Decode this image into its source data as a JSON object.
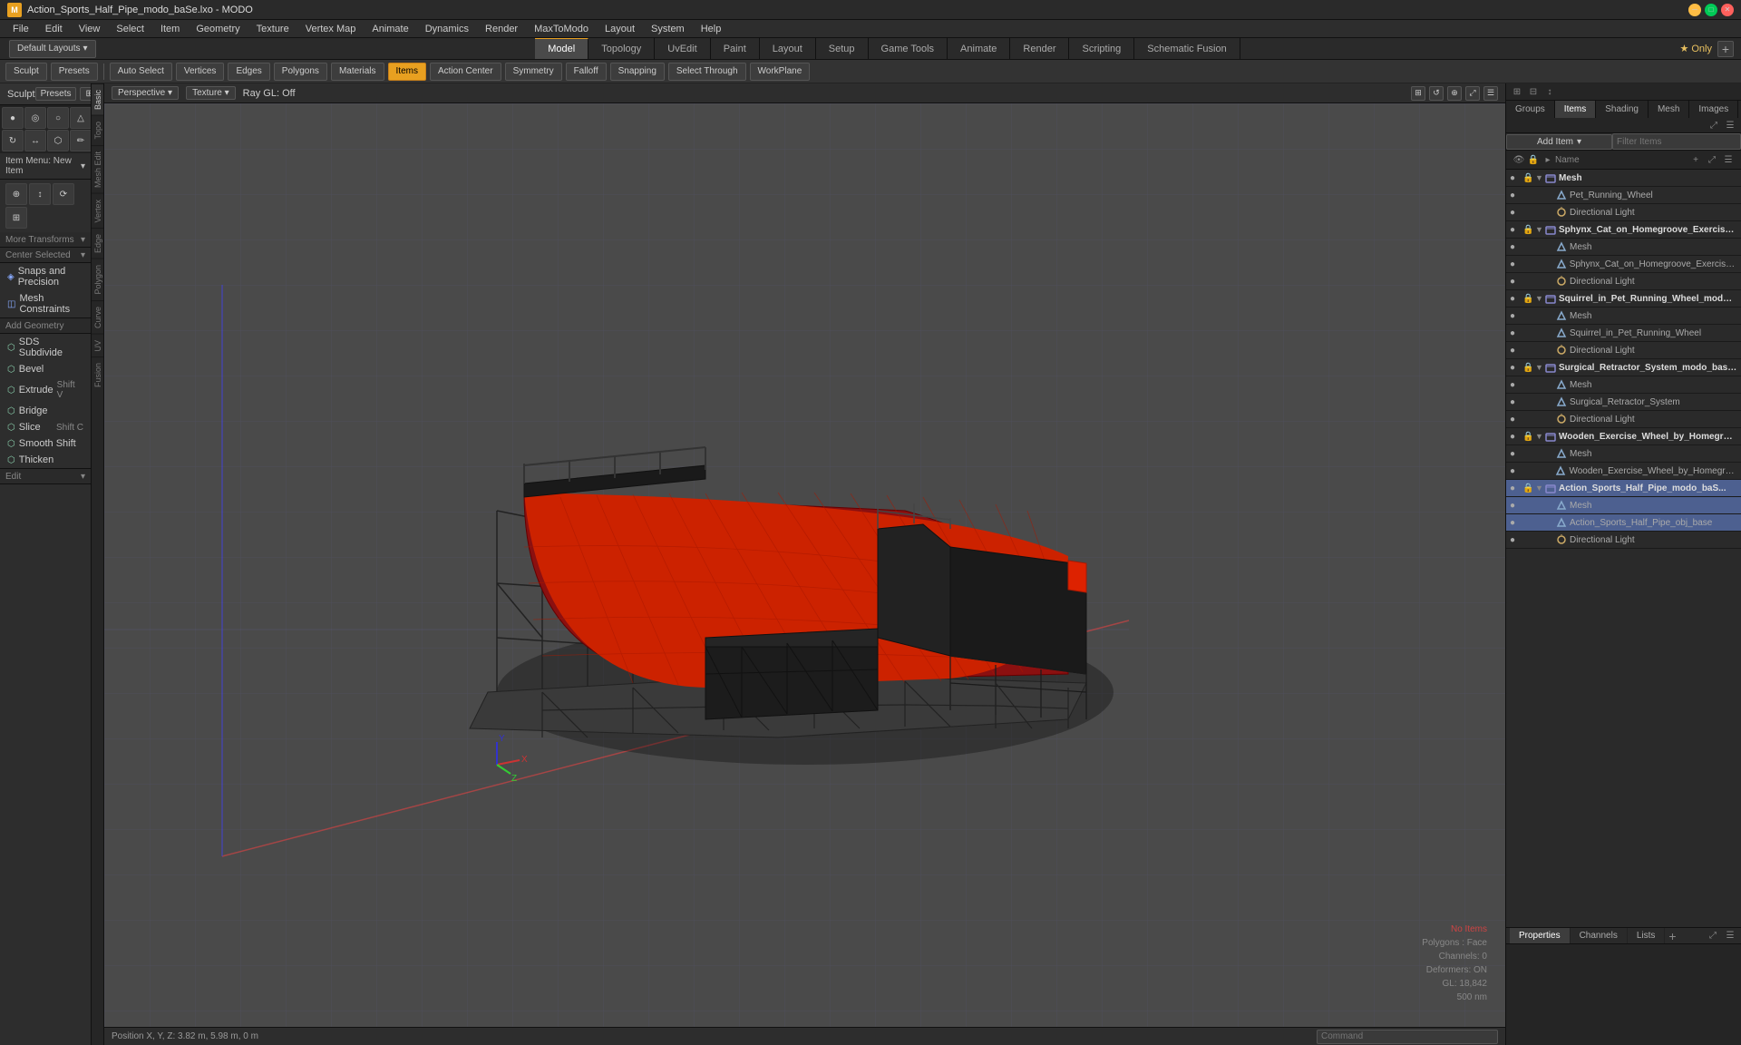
{
  "window": {
    "title": "Action_Sports_Half_Pipe_modo_baSe.lxo - MODO",
    "icon": "M"
  },
  "menu": {
    "items": [
      "File",
      "Edit",
      "View",
      "Select",
      "Item",
      "Geometry",
      "Texture",
      "Vertex Map",
      "Animate",
      "Dynamics",
      "Render",
      "MaxToModo",
      "Layout",
      "System",
      "Help"
    ]
  },
  "tabs": {
    "layout_dropdown": "Default Layouts",
    "items": [
      "Model",
      "Topology",
      "UvEdit",
      "Paint",
      "Layout",
      "Setup",
      "Game Tools",
      "Animate",
      "Render",
      "Scripting",
      "Schematic Fusion"
    ],
    "active": "Model",
    "right": {
      "star": "★ Only",
      "add": "+"
    }
  },
  "toolbar": {
    "sculpt": "Sculpt",
    "presets": "Presets",
    "buttons": [
      "Auto Select",
      "Vertices",
      "Edges",
      "Polygons",
      "Materials",
      "Items",
      "Action Center",
      "Symmetry",
      "Falloff",
      "Snapping",
      "Select Through",
      "WorkPlane"
    ],
    "active_button": "Items"
  },
  "left_panel": {
    "item_menu": "Item Menu: New Item",
    "more_transforms": "More Transforms",
    "center_selected": "Center Selected",
    "snaps_precision": "Snaps - Precision",
    "snaps_label": "Snaps and Precision",
    "mesh_constraints": "Mesh Constraints",
    "add_geometry": "Add Geometry",
    "tools": [
      {
        "label": "SDS Subdivide",
        "shortcut": ""
      },
      {
        "label": "Bevel",
        "shortcut": ""
      },
      {
        "label": "Extrude",
        "shortcut": "Shift V"
      },
      {
        "label": "Bridge",
        "shortcut": ""
      },
      {
        "label": "Slice",
        "shortcut": "Shift C"
      },
      {
        "label": "Smooth Shift",
        "shortcut": ""
      },
      {
        "label": "Thicken",
        "shortcut": ""
      }
    ],
    "edit": "Edit",
    "vtabs": [
      "Basic",
      "Topo",
      "Mesh Edit",
      "Vertex",
      "Edge",
      "Polygon",
      "Curve",
      "UV",
      "Fusion"
    ]
  },
  "viewport": {
    "mode": "Perspective",
    "shader": "Texture",
    "ray_gl": "Ray GL: Off"
  },
  "right_panel": {
    "tabs": [
      "Groups",
      "Items",
      "Shading",
      "Mesh",
      "Images"
    ],
    "active_tab": "Items",
    "add_item": "Add Item",
    "filter": "Filter Items",
    "col_name": "Name",
    "items": [
      {
        "level": 0,
        "type": "group",
        "label": "Mesh",
        "visible": true
      },
      {
        "level": 1,
        "type": "mesh",
        "label": "Pet_Running_Wheel",
        "visible": true
      },
      {
        "level": 1,
        "type": "light",
        "label": "Directional Light",
        "visible": true
      },
      {
        "level": 0,
        "type": "group",
        "label": "Sphynx_Cat_on_Homegroove_Exercise_W...",
        "visible": true
      },
      {
        "level": 1,
        "type": "mesh-tag",
        "label": "Mesh",
        "visible": true
      },
      {
        "level": 1,
        "type": "mesh",
        "label": "Sphynx_Cat_on_Homegroove_Exercise ...",
        "visible": true
      },
      {
        "level": 1,
        "type": "light",
        "label": "Directional Light",
        "visible": true
      },
      {
        "level": 0,
        "type": "group",
        "label": "Squirrel_in_Pet_Running_Wheel_modo_ba...",
        "visible": true
      },
      {
        "level": 1,
        "type": "mesh-tag",
        "label": "Mesh",
        "visible": true
      },
      {
        "level": 1,
        "type": "mesh",
        "label": "Squirrel_in_Pet_Running_Wheel",
        "visible": true
      },
      {
        "level": 1,
        "type": "light",
        "label": "Directional Light",
        "visible": true
      },
      {
        "level": 0,
        "type": "group",
        "label": "Surgical_Retractor_System_modo_base.lxo",
        "visible": true
      },
      {
        "level": 1,
        "type": "mesh-tag",
        "label": "Mesh",
        "visible": true
      },
      {
        "level": 1,
        "type": "mesh",
        "label": "Surgical_Retractor_System",
        "visible": true
      },
      {
        "level": 1,
        "type": "light",
        "label": "Directional Light",
        "visible": true
      },
      {
        "level": 0,
        "type": "group",
        "label": "Wooden_Exercise_Wheel_by_Homegroove...",
        "visible": true
      },
      {
        "level": 1,
        "type": "mesh-tag",
        "label": "Mesh",
        "visible": true
      },
      {
        "level": 1,
        "type": "mesh",
        "label": "Wooden_Exercise_Wheel_by_Homegroov...",
        "visible": true
      },
      {
        "level": 0,
        "type": "group",
        "label": "Action_Sports_Half_Pipe_modo_baS...",
        "visible": true,
        "selected": true
      },
      {
        "level": 1,
        "type": "mesh-tag",
        "label": "Mesh",
        "visible": true,
        "selected": true
      },
      {
        "level": 1,
        "type": "mesh",
        "label": "Action_Sports_Half_Pipe_obj_base",
        "visible": true,
        "selected": true
      },
      {
        "level": 1,
        "type": "light",
        "label": "Directional Light",
        "visible": true
      }
    ]
  },
  "bottom_panel": {
    "tabs": [
      "Properties",
      "Channels",
      "Lists"
    ],
    "active": "Properties",
    "stats": {
      "no_items": "No Items",
      "polygons": "Polygons : Face",
      "channels": "Channels: 0",
      "deformers": "Deformers: ON",
      "gl": "GL: 18,842",
      "size": "500 nm"
    }
  },
  "status_bar": {
    "position": "Position X, Y, Z:  3.82 m, 5.98 m, 0 m",
    "command_placeholder": "Command"
  }
}
